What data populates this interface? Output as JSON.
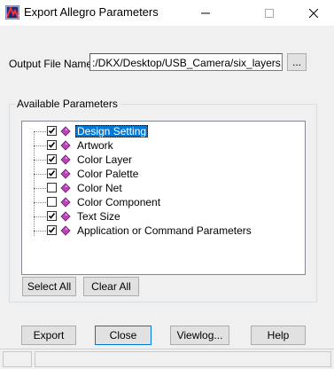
{
  "window": {
    "title": "Export Allegro Parameters"
  },
  "output": {
    "label": "Output File Name:",
    "value": ":/DKX/Desktop/USB_Camera/six_layers.prm",
    "browse_label": "..."
  },
  "parameters": {
    "group_label": "Available Parameters",
    "items": [
      {
        "label": "Design Setting",
        "checked": true,
        "selected": true
      },
      {
        "label": "Artwork",
        "checked": true,
        "selected": false
      },
      {
        "label": "Color Layer",
        "checked": true,
        "selected": false
      },
      {
        "label": "Color Palette",
        "checked": true,
        "selected": false
      },
      {
        "label": "Color Net",
        "checked": false,
        "selected": false
      },
      {
        "label": "Color Component",
        "checked": false,
        "selected": false
      },
      {
        "label": "Text Size",
        "checked": true,
        "selected": false
      },
      {
        "label": "Application or Command Parameters",
        "checked": true,
        "selected": false
      }
    ],
    "select_all_label": "Select All",
    "clear_all_label": "Clear All"
  },
  "buttons": {
    "export": "Export",
    "close": "Close",
    "viewlog": "Viewlog...",
    "help": "Help"
  },
  "colors": {
    "selection": "#0078d7",
    "gem": "#c040c0"
  }
}
